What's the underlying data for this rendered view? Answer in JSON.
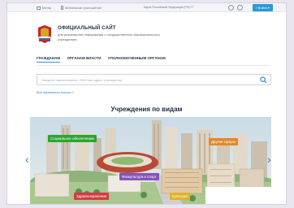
{
  "topbar": {
    "link1": "Меню",
    "link2": "Мобильное приложение",
    "region": "Карта Российской Федерации (РФ) 77",
    "login": "Войти"
  },
  "header": {
    "title": "ОФИЦИАЛЬНЫЙ САЙТ",
    "subtitle": "для размещения информации о государственных (муниципальных) учреждениях"
  },
  "nav": {
    "tabs": [
      "ГРАЖДАНАМ",
      "ОРГАНАМ ВЛАСТИ",
      "УПОЛНОМОЧЕННЫМ ОРГАНАМ"
    ]
  },
  "search": {
    "placeholder": "Введите наименование, ИНН или адрес учреждения",
    "extended": "Все параметры поиска »"
  },
  "section": {
    "title": "Учреждения по видам"
  },
  "categories": [
    {
      "label": "Социальное обеспечение",
      "color": "#2aa52d"
    },
    {
      "label": "Другие сферы",
      "color": "#e1892a"
    },
    {
      "label": "Физкультура и спорт",
      "color": "#8455b6"
    },
    {
      "label": "Здравоохранение",
      "color": "#d23c44"
    },
    {
      "label": "Культура",
      "color": "#e0b32c"
    }
  ],
  "icons": {
    "prev": "‹",
    "next": "›"
  }
}
